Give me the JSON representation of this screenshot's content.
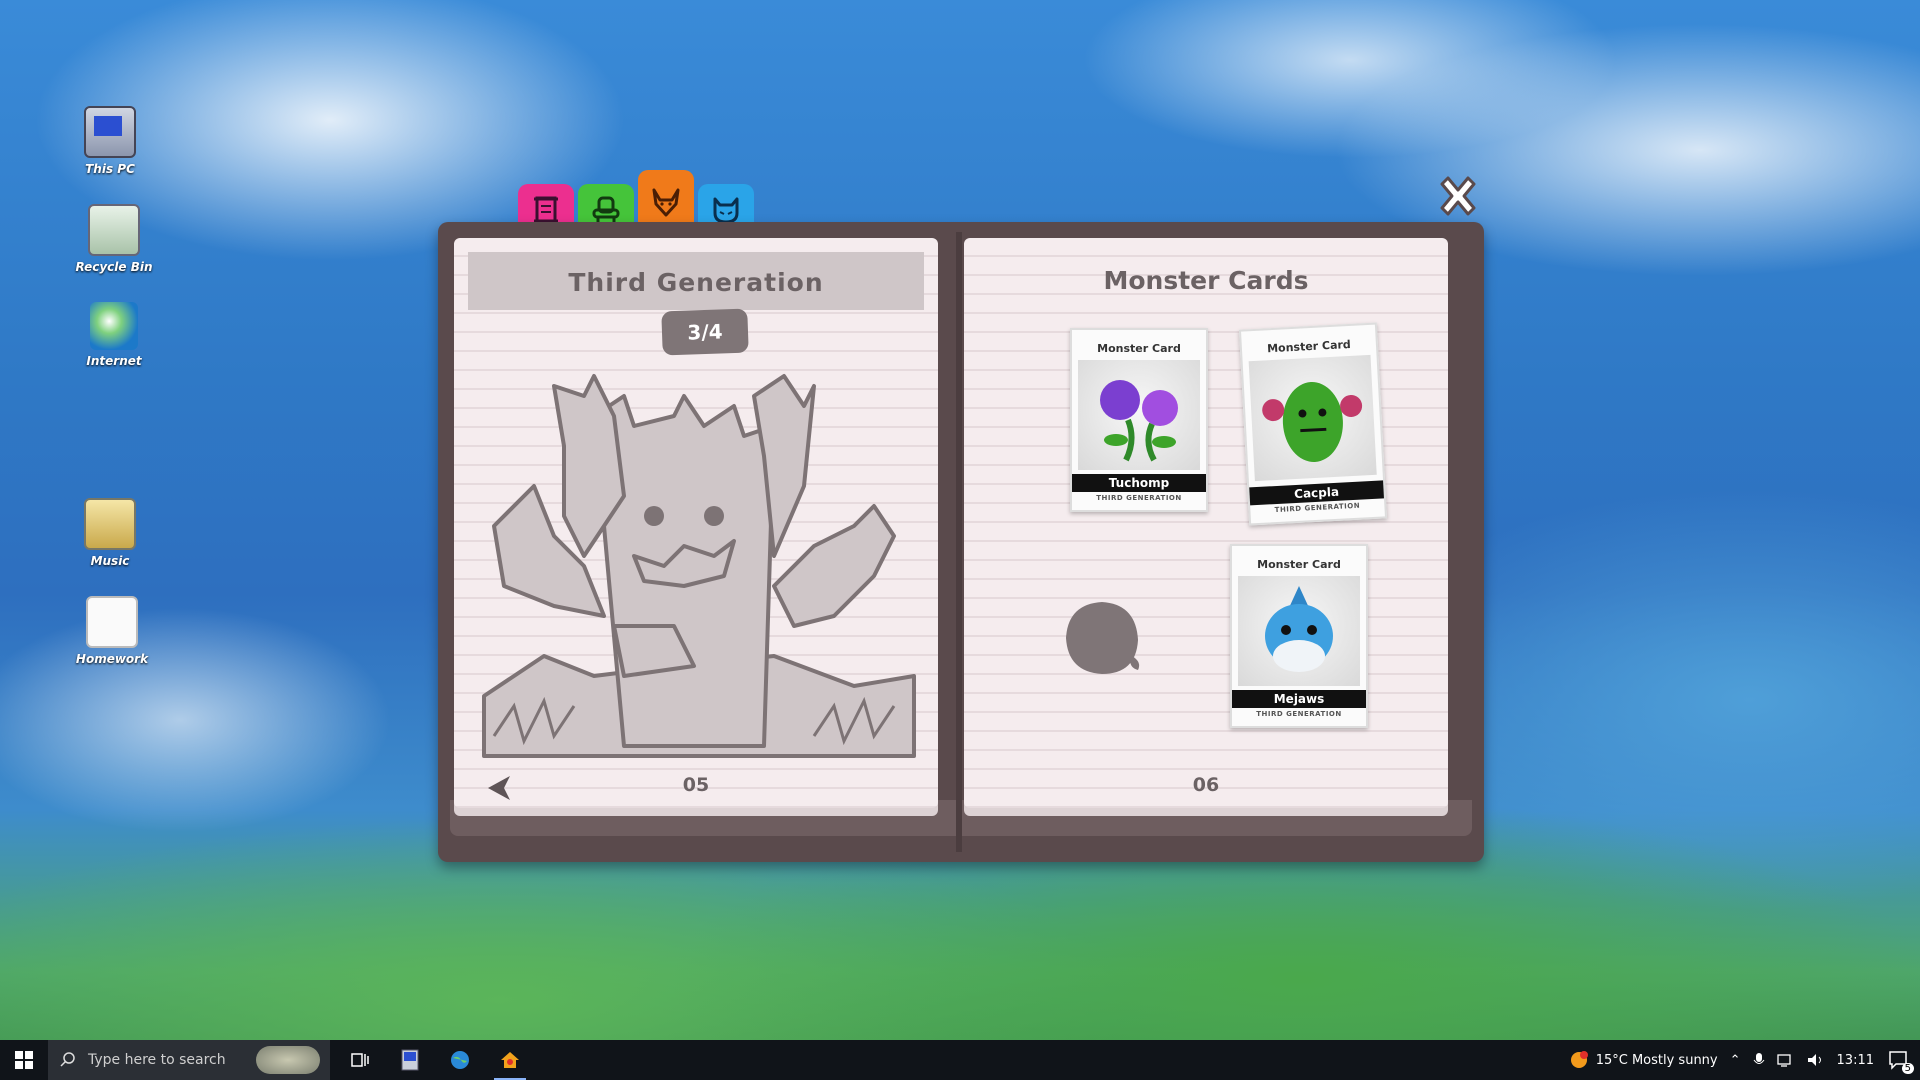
{
  "desktop": {
    "icons": [
      {
        "label": "This PC",
        "icon": "computer-icon"
      },
      {
        "label": "Recycle Bin",
        "icon": "recycle-bin-icon"
      },
      {
        "label": "Internet",
        "icon": "globe-icon"
      },
      {
        "label": "Music",
        "icon": "music-icon"
      },
      {
        "label": "Homework",
        "icon": "document-icon"
      }
    ]
  },
  "tabs": [
    {
      "name": "scroll-tab",
      "color": "#ec2f8f",
      "icon": "scroll-icon"
    },
    {
      "name": "chair-tab",
      "color": "#45c43a",
      "icon": "chair-icon"
    },
    {
      "name": "fox-tab",
      "color": "#f07a1a",
      "icon": "fox-icon",
      "active": true
    },
    {
      "name": "cat-tab",
      "color": "#2aa4e8",
      "icon": "cat-icon"
    }
  ],
  "left_page": {
    "title": "Third Generation",
    "progress": "3/4",
    "page_number": "05"
  },
  "right_page": {
    "title": "Monster Cards",
    "page_number": "06",
    "cards": [
      {
        "caption": "Monster Card",
        "name": "Tuchomp",
        "generation": "THIRD GENERATION",
        "color": "#7b3fd0"
      },
      {
        "caption": "Monster Card",
        "name": "Cacpla",
        "generation": "THIRD GENERATION",
        "color": "#3da42a"
      },
      {
        "caption": "Monster Card",
        "name": "Mejaws",
        "generation": "THIRD GENERATION",
        "color": "#3ea0e0"
      }
    ]
  },
  "taskbar": {
    "search_placeholder": "Type here to search",
    "weather": "15°C  Mostly sunny",
    "time": "13:11",
    "notifications": "5"
  }
}
